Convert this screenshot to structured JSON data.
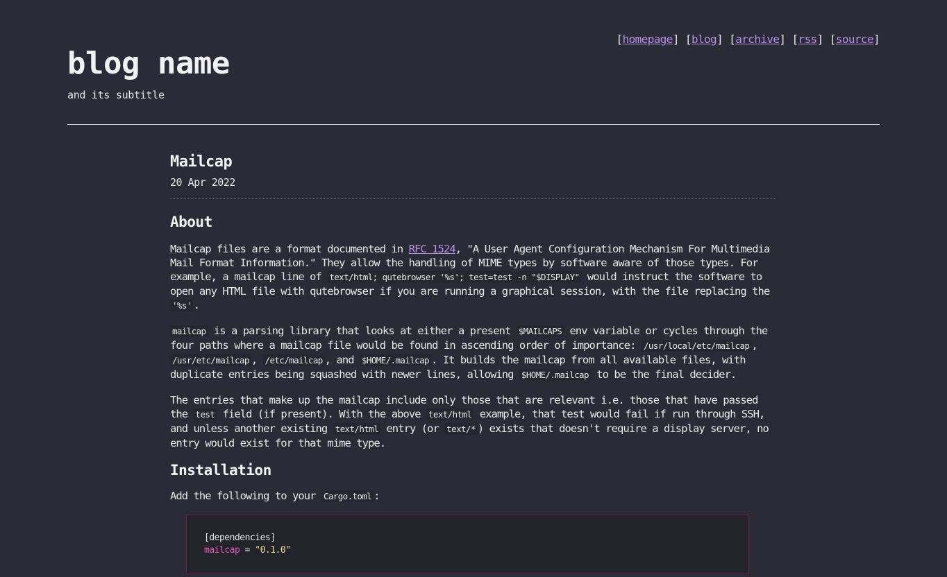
{
  "header": {
    "title": "blog name",
    "subtitle": "and its subtitle",
    "nav": [
      {
        "label": "homepage"
      },
      {
        "label": "blog"
      },
      {
        "label": "archive"
      },
      {
        "label": "rss"
      },
      {
        "label": "source"
      }
    ]
  },
  "post": {
    "title": "Mailcap",
    "date": "20 Apr 2022",
    "about": {
      "heading": "About",
      "p1": {
        "t1": "Mailcap files are a format documented in ",
        "link": "RFC 1524",
        "t2": ", \"A User Agent Configuration Mechanism For Multimedia Mail Format Information.\" They allow the handling of MIME types by software aware of those types. For example, a mailcap line of ",
        "code1": "text/html; qutebrowser '%s'; test=test -n \"$DISPLAY\"",
        "t3": " would instruct the software to open any HTML file with qutebrowser if you are running a graphical session, with the file replacing the ",
        "code2": "'%s'",
        "t4": "."
      },
      "p2": {
        "code1": "mailcap",
        "t1": " is a parsing library that looks at either a present ",
        "code2": "$MAILCAPS",
        "t2": " env variable or cycles through the four paths where a mailcap file would be found in ascending order of importance: ",
        "code3": "/usr/local/etc/mailcap",
        "t3": ", ",
        "code4": "/usr/etc/mailcap",
        "t4": ", ",
        "code5": "/etc/mailcap",
        "t5": ", and ",
        "code6": "$HOME/.mailcap",
        "t6": ". It builds the mailcap from all available files, with duplicate entries being squashed with newer lines, allowing ",
        "code7": "$HOME/.mailcap",
        "t7": " to be the final decider."
      },
      "p3": {
        "t1": "The entries that make up the mailcap include only those that are relevant i.e. those that have passed the ",
        "code1": "test",
        "t2": " field (if present). With the above ",
        "code2": "text/html",
        "t3": " example, that test would fail if run through SSH, and unless another existing ",
        "code3": "text/html",
        "t4": " entry (or ",
        "code4": "text/*",
        "t5": ") exists that doesn't require a display server, no entry would exist for that mime type."
      }
    },
    "installation": {
      "heading": "Installation",
      "p": {
        "t1": "Add the following to your ",
        "code1": "Cargo.toml",
        "t2": ":"
      },
      "codeblock": {
        "line1": "[dependencies]",
        "key": "mailcap",
        "eq": " = ",
        "value": "\"0.1.0\""
      }
    }
  },
  "colors": {
    "background": "#2a2b36",
    "link": "#b592e6",
    "text": "#e8e8ea",
    "code_key": "#e05db0",
    "code_string": "#e6e08a",
    "codeblock_border": "#5e2547"
  }
}
